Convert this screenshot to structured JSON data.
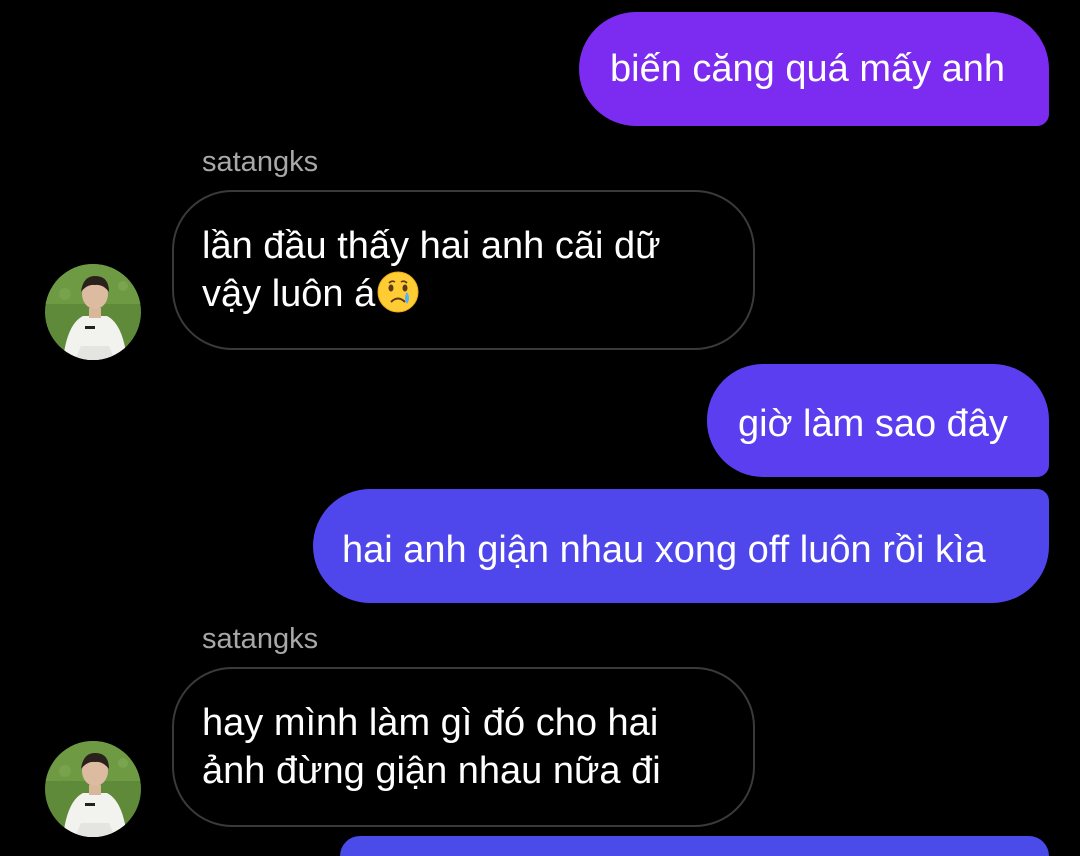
{
  "messages": [
    {
      "type": "sent",
      "text": "biến căng quá mấy anh"
    },
    {
      "type": "received",
      "sender": "satangks",
      "lines": [
        "lần đầu thấy hai anh cãi dữ",
        "vậy luôn á"
      ],
      "emoji": "crying-face"
    },
    {
      "type": "sent",
      "text": "giờ làm sao đây"
    },
    {
      "type": "sent",
      "text": "hai anh giận nhau xong off luôn rồi kìa"
    },
    {
      "type": "received",
      "sender": "satangks",
      "lines": [
        "hay mình làm gì đó cho hai",
        "ảnh đừng giận nhau nữa đi"
      ]
    }
  ],
  "colors": {
    "background": "#000000",
    "sent_bubble_1": "#7b2cf0",
    "sent_bubble_2": "#5b3ef0",
    "sent_bubble_3": "#4f46ec",
    "received_border": "#3a3a3c",
    "sender_name": "#a8a8a8"
  },
  "icons": {
    "avatar": "user-avatar-photo",
    "emoji": "crying-face-emoji"
  }
}
